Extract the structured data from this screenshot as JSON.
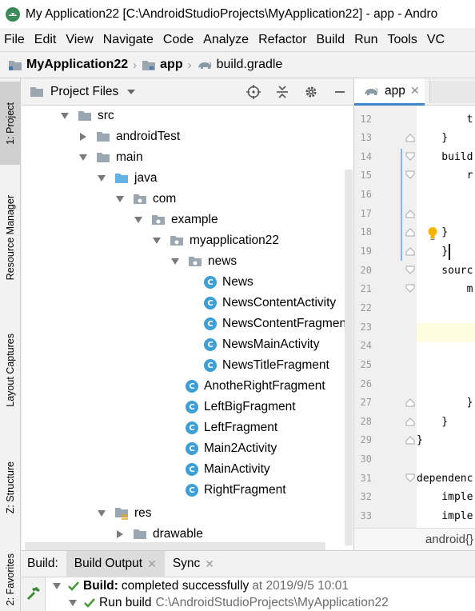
{
  "window": {
    "title": "My Application22 [C:\\AndroidStudioProjects\\MyApplication22] - app - Andro"
  },
  "menu": [
    "File",
    "Edit",
    "View",
    "Navigate",
    "Code",
    "Analyze",
    "Refactor",
    "Build",
    "Run",
    "Tools",
    "VC"
  ],
  "breadcrumbs": [
    "MyApplication22",
    "app",
    "build.gradle"
  ],
  "left_tabs": [
    "1: Project",
    "Resource Manager",
    "Layout Captures",
    "Z: Structure",
    "2: Favorites"
  ],
  "project_panel": {
    "title": "Project Files",
    "tree": [
      {
        "label": "src",
        "expanded": true
      },
      {
        "label": "androidTest",
        "expanded": false
      },
      {
        "label": "main",
        "expanded": true
      },
      {
        "label": "java",
        "expanded": true
      },
      {
        "label": "com",
        "expanded": true
      },
      {
        "label": "example",
        "expanded": true
      },
      {
        "label": "myapplication22",
        "expanded": true
      },
      {
        "label": "news",
        "expanded": true
      },
      {
        "label": "News"
      },
      {
        "label": "NewsContentActivity"
      },
      {
        "label": "NewsContentFragment"
      },
      {
        "label": "NewsMainActivity"
      },
      {
        "label": "NewsTitleFragment"
      },
      {
        "label": "AnotheRightFragment"
      },
      {
        "label": "LeftBigFragment"
      },
      {
        "label": "LeftFragment"
      },
      {
        "label": "Main2Activity"
      },
      {
        "label": "MainActivity"
      },
      {
        "label": "RightFragment"
      },
      {
        "label": "res",
        "expanded": true
      },
      {
        "label": "drawable",
        "expanded": false
      }
    ]
  },
  "editor": {
    "tab_label": "app",
    "line_numbers": [
      "12",
      "13",
      "14",
      "15",
      "16",
      "17",
      "18",
      "19",
      "20",
      "21",
      "22",
      "23",
      "24",
      "25",
      "26",
      "27",
      "28",
      "29",
      "30",
      "31",
      "32",
      "33"
    ],
    "code_lines": [
      "        t",
      "    }",
      "    build",
      "        r",
      "",
      "",
      "    }",
      "    }",
      "    sourc",
      "        m",
      "",
      "",
      "",
      "",
      "",
      "        }",
      "    }",
      "}",
      "",
      "dependenc",
      "    imple",
      "    imple"
    ],
    "breadcrumb": "android{}"
  },
  "build_panel": {
    "label": "Build:",
    "tabs": [
      "Build Output",
      "Sync"
    ],
    "row1_bold": "Build:",
    "row1_text": "completed successfully",
    "row1_time": "at 2019/9/5 10:01",
    "row2_text": "Run build",
    "row2_path": "C:\\AndroidStudioProjects\\MyApplication22"
  }
}
